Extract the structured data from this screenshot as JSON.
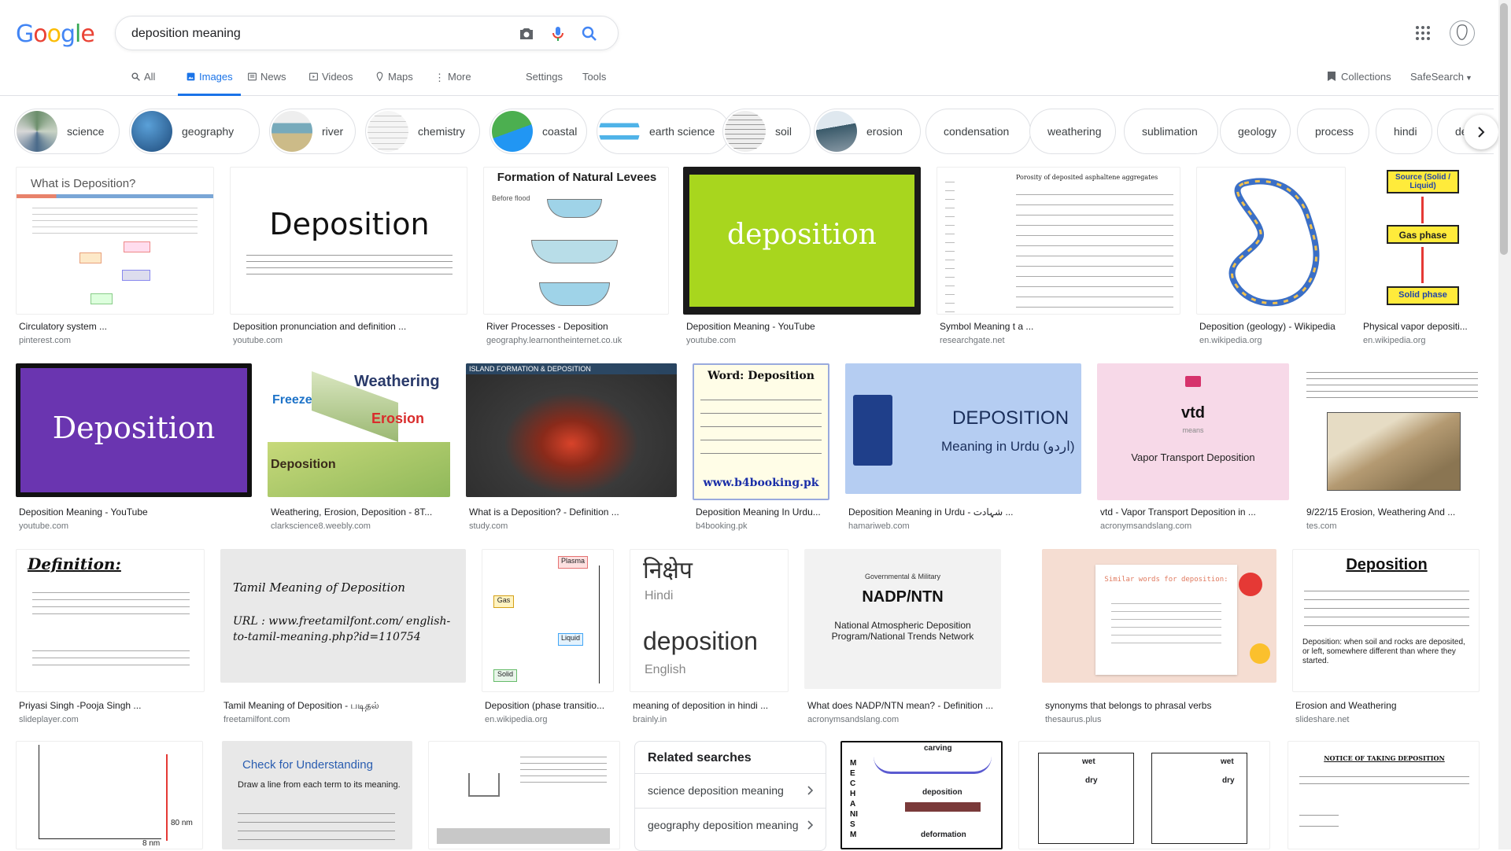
{
  "logo": {
    "text": "Google"
  },
  "search": {
    "value": "deposition meaning"
  },
  "tabs": [
    {
      "label": "All",
      "icon": "search-icon"
    },
    {
      "label": "Images",
      "icon": "image-icon",
      "active": true
    },
    {
      "label": "News",
      "icon": "news-icon"
    },
    {
      "label": "Videos",
      "icon": "video-icon"
    },
    {
      "label": "Maps",
      "icon": "map-pin-icon"
    },
    {
      "label": "More",
      "icon": "more-vert-icon"
    }
  ],
  "tools": {
    "settings": "Settings",
    "tools": "Tools",
    "collections": "Collections",
    "safesearch": "SafeSearch"
  },
  "colors": {
    "accent": "#1a73e8",
    "border": "#dfe1e5",
    "muted": "#70757a"
  },
  "chips": [
    {
      "label": "science",
      "thumb": true
    },
    {
      "label": "geography",
      "thumb": true
    },
    {
      "label": "river",
      "thumb": true
    },
    {
      "label": "chemistry",
      "thumb": true
    },
    {
      "label": "coastal",
      "thumb": true
    },
    {
      "label": "earth science",
      "thumb": true
    },
    {
      "label": "soil",
      "thumb": true
    },
    {
      "label": "erosion",
      "thumb": true
    },
    {
      "label": "condensation",
      "thumb": false
    },
    {
      "label": "weathering",
      "thumb": false
    },
    {
      "label": "sublimation",
      "thumb": false
    },
    {
      "label": "geology",
      "thumb": false
    },
    {
      "label": "process",
      "thumb": false
    },
    {
      "label": "hindi",
      "thumb": false
    },
    {
      "label": "de",
      "thumb": false
    }
  ],
  "results": {
    "row1": [
      {
        "title": "Circulatory system ...",
        "source": "pinterest.com",
        "img_text": "What is Deposition?"
      },
      {
        "title": "Deposition pronunciation and definition ...",
        "source": "youtube.com",
        "img_text": "Deposition"
      },
      {
        "title": "River Processes - Deposition",
        "source": "geography.learnontheinternet.co.uk",
        "img_text": "Formation of Natural Levees"
      },
      {
        "title": "Deposition Meaning - YouTube",
        "source": "youtube.com",
        "img_text": "deposition"
      },
      {
        "title": "Symbol Meaning t a ...",
        "source": "researchgate.net",
        "img_text": "Porosity of deposited asphaltene aggregates"
      },
      {
        "title": "Deposition (geology) - Wikipedia",
        "source": "en.wikipedia.org",
        "img_text": ""
      },
      {
        "title": "Physical vapor depositi...",
        "source": "en.wikipedia.org",
        "img_text": "Gas phase"
      }
    ],
    "row2": [
      {
        "title": "Deposition Meaning - YouTube",
        "source": "youtube.com",
        "img_text": "Deposition"
      },
      {
        "title": "Weathering, Erosion, Deposition - 8T...",
        "source": "clarkscience8.weebly.com",
        "img_text": "Weathering"
      },
      {
        "title": "What is a Deposition? - Definition ...",
        "source": "study.com",
        "img_text": "ISLAND FORMATION & DEPOSITION"
      },
      {
        "title": "Deposition Meaning In Urdu...",
        "source": "b4booking.pk",
        "img_text": "Word: Deposition"
      },
      {
        "title": "Deposition Meaning in Urdu - شہادت ...",
        "source": "hamariweb.com",
        "img_text": "DEPOSITION"
      },
      {
        "title": "vtd - Vapor Transport Deposition in ...",
        "source": "acronymsandslang.com",
        "img_text": "vtd"
      },
      {
        "title": "9/22/15 Erosion, Weathering And ...",
        "source": "tes.com",
        "img_text": ""
      }
    ],
    "row3": [
      {
        "title": "Priyasi Singh -Pooja Singh ...",
        "source": "slideplayer.com",
        "img_text": "Definition:"
      },
      {
        "title": "Tamil Meaning of Deposition - படிதல்",
        "source": "freetamilfont.com",
        "img_text": "Tamil Meaning of Deposition"
      },
      {
        "title": "Deposition (phase transitio...",
        "source": "en.wikipedia.org",
        "img_text": "Plasma"
      },
      {
        "title": "meaning of deposition in hindi ...",
        "source": "brainly.in",
        "img_text": "निक्षेप"
      },
      {
        "title": "What does NADP/NTN mean? - Definition ...",
        "source": "acronymsandslang.com",
        "img_text": "NADP/NTN"
      },
      {
        "title": "synonyms that belongs to phrasal verbs",
        "source": "thesaurus.plus",
        "img_text": "Similar words for deposition:"
      },
      {
        "title": "Erosion and Weathering",
        "source": "slideshare.net",
        "img_text": "Deposition"
      }
    ]
  },
  "img_extra": {
    "levees_sub": "Before flood",
    "urdu_label": "Meaning in Urdu (اردو)",
    "vtd_sub": "Vapor Transport Deposition",
    "vtd_means": "means",
    "hindi_label": "Hindi",
    "english_label": "English",
    "english_word": "deposition",
    "nadp_top": "Governmental & Military",
    "nadp_full": "National Atmospheric Deposition Program/National Trends Network",
    "tamil_url": "URL : www.freetamilfont.com/ english-to-tamil-meaning.php?id=110754",
    "erosion_deposition_def": "Deposition: when soil and rocks are deposited, or left, somewhere different than where they started.",
    "check_title": "Check for Understanding",
    "check_sub": "Draw a line from each term to its meaning.",
    "mech_top": "carving",
    "mech_mid": "deposition",
    "mech_bottom": "deformation",
    "mech_side": "MECHANISM",
    "notice": "NOTICE OF TAKING DEPOSITION",
    "b4_url": "www.b4booking.pk",
    "weather_erosion": "Erosion",
    "weather_deposition": "Deposition",
    "weather_freeze": "Freeze",
    "wiki_gas": "Gas",
    "wiki_liquid": "Liquid",
    "wiki_solid": "Solid",
    "pvd_source": "Source (Solid / Liquid)",
    "pvd_solid": "Solid phase",
    "chart_label": "80 nm",
    "chart_label2": "8 nm",
    "dry_label": "dry",
    "wet_label": "wet"
  },
  "related": {
    "heading": "Related searches",
    "items": [
      "science deposition meaning",
      "geography deposition meaning"
    ]
  }
}
